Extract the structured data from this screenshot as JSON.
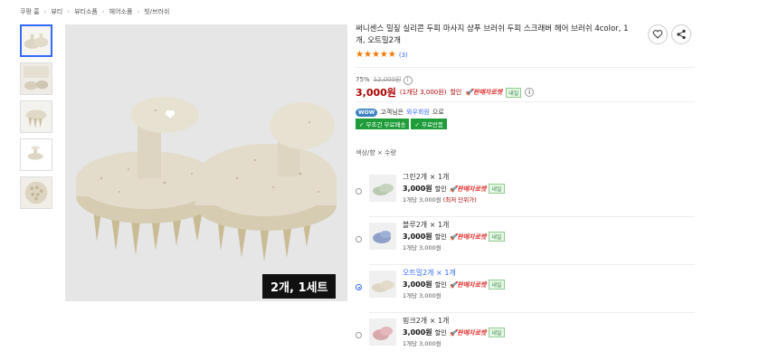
{
  "breadcrumb": [
    "쿠팡 홈",
    "뷰티",
    "뷰티소품",
    "헤어소품",
    "빗/브러쉬"
  ],
  "thumbnails": [
    "thumb-1",
    "thumb-2",
    "thumb-3",
    "thumb-4",
    "thumb-5"
  ],
  "main_image": {
    "badge": "2개, 1세트"
  },
  "product": {
    "title": "써니센스 밀짚 실리콘 두피 마사지 샴푸 브러쉬 두피 스크래버 헤어 브러쉬 4color, 1개, 오트밀2개",
    "rating": 5,
    "review_count": "(3)",
    "discount_rate": "75%",
    "original_price": "12,000원",
    "price": "3,000원",
    "unit_price": "(1개당 3,000원)",
    "sale_label": "할인",
    "rocket": "판매자로켓",
    "tomorrow": "내일",
    "wow_badge": "WOW",
    "wow_text": "고객님은",
    "wow_link": "와우회원",
    "wow_suffix": "으로",
    "ship_free": "무조건 무료배송",
    "return_free": "무료반품"
  },
  "options_label": "색상/향 × 수량",
  "options": [
    {
      "name": "그린2개 × 1개",
      "price": "3,000원",
      "sale": "할인",
      "rocket": "판매자로켓",
      "tomorrow": "내일",
      "unit": "1개당 3,000원",
      "note": "(최저 단위가)",
      "selected": false
    },
    {
      "name": "블루2개 × 1개",
      "price": "3,000원",
      "sale": "할인",
      "rocket": "판매자로켓",
      "tomorrow": "내일",
      "unit": "1개당 3,000원",
      "note": "",
      "selected": false
    },
    {
      "name": "오트밀2개 × 1개",
      "price": "3,000원",
      "sale": "할인",
      "rocket": "판매자로켓",
      "tomorrow": "내일",
      "unit": "1개당 3,000원",
      "note": "",
      "selected": true
    },
    {
      "name": "핑크2개 × 1개",
      "price": "3,000원",
      "sale": "할인",
      "rocket": "판매자로켓",
      "tomorrow": "내일",
      "unit": "1개당 3,000원",
      "note": "",
      "selected": false
    }
  ],
  "colors": {
    "accent": "#346aff",
    "price_red": "#ae0000",
    "rocket_red": "#e0302d",
    "ship_green": "#1e9d3a",
    "star": "#f07a00"
  }
}
